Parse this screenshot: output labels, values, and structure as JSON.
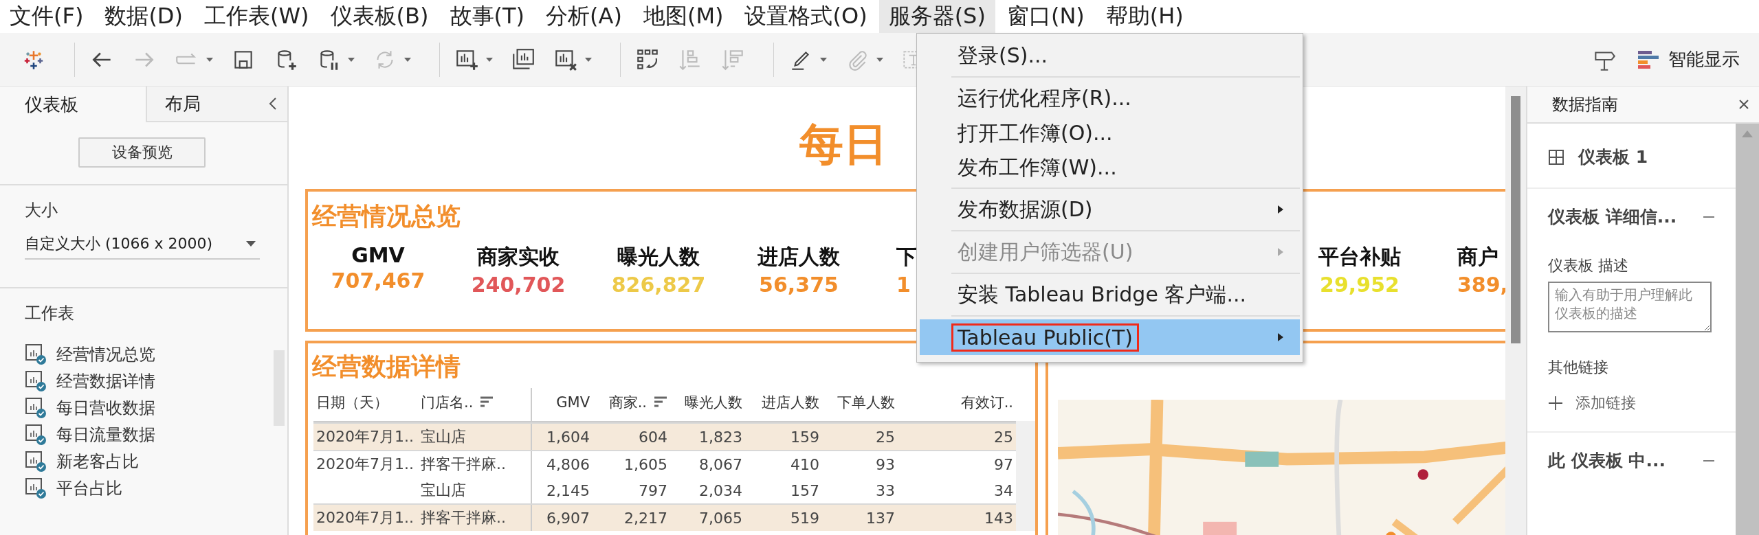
{
  "menu_bar": [
    {
      "label": "文件(F)",
      "selected": false
    },
    {
      "label": "数据(D)",
      "selected": false
    },
    {
      "label": "工作表(W)",
      "selected": false
    },
    {
      "label": "仪表板(B)",
      "selected": false
    },
    {
      "label": "故事(T)",
      "selected": false
    },
    {
      "label": "分析(A)",
      "selected": false
    },
    {
      "label": "地图(M)",
      "selected": false
    },
    {
      "label": "设置格式(O)",
      "selected": false
    },
    {
      "label": "服务器(S)",
      "selected": true
    },
    {
      "label": "窗口(N)",
      "selected": false
    },
    {
      "label": "帮助(H)",
      "selected": false
    }
  ],
  "toolbar": {
    "buttons": [
      {
        "kind": "logo"
      },
      {
        "kind": "separator"
      },
      {
        "kind": "back",
        "disabled": false,
        "dropdown": false
      },
      {
        "kind": "forward",
        "disabled": true,
        "dropdown": false
      },
      {
        "kind": "redo",
        "disabled": true,
        "dropdown": true
      },
      {
        "kind": "save",
        "disabled": false,
        "dropdown": false
      },
      {
        "kind": "add-data",
        "disabled": false,
        "dropdown": false
      },
      {
        "kind": "pause-data",
        "disabled": false,
        "dropdown": true
      },
      {
        "kind": "refresh",
        "disabled": true,
        "dropdown": true
      },
      {
        "kind": "separator"
      },
      {
        "kind": "new-sheet",
        "disabled": false,
        "dropdown": true
      },
      {
        "kind": "duplicate-sheet",
        "disabled": false,
        "dropdown": false
      },
      {
        "kind": "clear-sheet",
        "disabled": false,
        "dropdown": true
      },
      {
        "kind": "separator"
      },
      {
        "kind": "swap",
        "disabled": false,
        "dropdown": false
      },
      {
        "kind": "sort-asc",
        "disabled": true,
        "dropdown": false
      },
      {
        "kind": "sort-desc",
        "disabled": true,
        "dropdown": false
      },
      {
        "kind": "separator"
      },
      {
        "kind": "highlight",
        "disabled": false,
        "dropdown": true
      },
      {
        "kind": "attach",
        "disabled": true,
        "dropdown": true
      },
      {
        "kind": "text-box",
        "disabled": true,
        "dropdown": false
      }
    ],
    "show_me": "智能显示"
  },
  "left_panel": {
    "tabs": [
      {
        "label": "仪表板",
        "selected": true
      },
      {
        "label": "布局",
        "selected": false
      }
    ],
    "device_preview": "设备预览",
    "size_label": "大小",
    "size_value": "自定义大小 (1066 x 2000)",
    "sheets_label": "工作表",
    "sheets": [
      "经营情况总览",
      "经营数据详情",
      "每日营收数据",
      "每日流量数据",
      "新老客占比",
      "平台占比"
    ]
  },
  "dashboard": {
    "title": "每日",
    "overview": {
      "title": "经营情况总览",
      "kpis_left": [
        {
          "kind": "full",
          "label": "GMV",
          "value": "707,467",
          "color": "#f28e2b"
        },
        {
          "kind": "full",
          "label": "商家实收",
          "value": "240,702",
          "color": "#e15759"
        },
        {
          "kind": "full",
          "label": "曝光人数",
          "value": "826,827",
          "color": "#edc948"
        },
        {
          "kind": "full",
          "label": "进店人数",
          "value": "56,375",
          "color": "#f28e2b"
        },
        {
          "kind": "cut",
          "label": "下",
          "value": "1",
          "color": "#f28e2b"
        }
      ],
      "kpis_right": [
        {
          "kind": "full",
          "label": "平台补贴",
          "value": "29,952",
          "color": "#e8e02e"
        },
        {
          "kind": "cut",
          "label": "商户",
          "value": "389,",
          "color": "#f28e2b"
        }
      ]
    },
    "details": {
      "title": "经营数据详情",
      "columns": [
        {
          "label": "日期（天）",
          "sorted": false
        },
        {
          "label": "门店名..",
          "sorted": true
        },
        {
          "label": "GMV",
          "sorted": false
        },
        {
          "label": "商家..",
          "sorted": true
        },
        {
          "label": "曝光人数",
          "sorted": false
        },
        {
          "label": "进店人数",
          "sorted": false
        },
        {
          "label": "下单人数",
          "sorted": false
        },
        {
          "label": "有效订..",
          "sorted": false
        }
      ],
      "rows": [
        {
          "shaded": true,
          "cells": [
            "2020年7月1..",
            "宝山店",
            "1,604",
            "604",
            "1,823",
            "159",
            "25",
            "25"
          ]
        },
        {
          "shaded": false,
          "cells": [
            "2020年7月1..",
            "拌客干拌麻..",
            "4,806",
            "1,605",
            "8,067",
            "410",
            "93",
            "97"
          ]
        },
        {
          "shaded": false,
          "cells": [
            "",
            "宝山店",
            "2,145",
            "797",
            "2,034",
            "157",
            "33",
            "34"
          ]
        },
        {
          "shaded": true,
          "cells": [
            "2020年7月1..",
            "拌客干拌麻..",
            "6,907",
            "2,217",
            "7,065",
            "519",
            "137",
            "143"
          ]
        }
      ]
    }
  },
  "server_menu": {
    "items": [
      {
        "kind": "item",
        "label": "登录(S)...",
        "submenu": false,
        "disabled": false,
        "selected": false,
        "outlined": false
      },
      {
        "kind": "separator"
      },
      {
        "kind": "item",
        "label": "运行优化程序(R)...",
        "submenu": false,
        "disabled": false,
        "selected": false,
        "outlined": false
      },
      {
        "kind": "item",
        "label": "打开工作簿(O)...",
        "submenu": false,
        "disabled": false,
        "selected": false,
        "outlined": false
      },
      {
        "kind": "item",
        "label": "发布工作簿(W)...",
        "submenu": false,
        "disabled": false,
        "selected": false,
        "outlined": false
      },
      {
        "kind": "separator"
      },
      {
        "kind": "item",
        "label": "发布数据源(D)",
        "submenu": true,
        "disabled": false,
        "selected": false,
        "outlined": false
      },
      {
        "kind": "separator"
      },
      {
        "kind": "item",
        "label": "创建用户筛选器(U)",
        "submenu": true,
        "disabled": true,
        "selected": false,
        "outlined": false
      },
      {
        "kind": "separator"
      },
      {
        "kind": "item",
        "label": "安装 Tableau Bridge 客户端...",
        "submenu": false,
        "disabled": false,
        "selected": false,
        "outlined": false
      },
      {
        "kind": "separator"
      },
      {
        "kind": "item",
        "label": "Tableau Public(T)",
        "submenu": true,
        "disabled": false,
        "selected": true,
        "outlined": true
      }
    ]
  },
  "data_guide": {
    "title": "数据指南",
    "dashboard_name": "仪表板 1",
    "details_section": {
      "title": "仪表板 详细信...",
      "expanded": true
    },
    "description_label": "仪表板 描述",
    "description_placeholder": "输入有助于用户理解此仪表板的描述",
    "links_label": "其他链接",
    "add_link": "添加链接",
    "contents_section": {
      "title": "此 仪表板 中...",
      "expanded": true
    }
  }
}
